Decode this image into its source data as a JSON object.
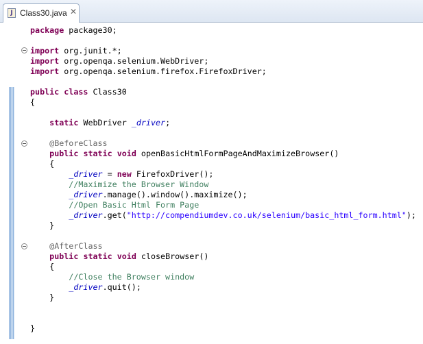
{
  "tab": {
    "icon_letter": "J",
    "filename": "Class30.java",
    "close_glyph": "✕"
  },
  "code": {
    "package_kw": "package",
    "package_rest": " package30;",
    "imports": [
      {
        "kw": "import",
        "rest": " org.junit.*;"
      },
      {
        "kw": "import",
        "rest": " org.openqa.selenium.WebDriver;"
      },
      {
        "kw": "import",
        "rest": " org.openqa.selenium.firefox.FirefoxDriver;"
      }
    ],
    "class_kw1": "public",
    "class_kw2": "class",
    "class_name": " Class30",
    "open_brace": "{",
    "field_kw": "static",
    "field_type": " WebDriver ",
    "field_name": "_driver",
    "field_end": ";",
    "before_ann": "@BeforeClass",
    "m1_kw1": "public",
    "m1_kw2": "static",
    "m1_kw3": "void",
    "m1_sig": " openBasicHtmlFormPageAndMaximizeBrowser()",
    "m1_open": "{",
    "m1_l1_var": "_driver",
    "m1_l1_mid": " = ",
    "m1_l1_new": "new",
    "m1_l1_end": " FirefoxDriver();",
    "m1_c1": "//Maximize the Browser Window",
    "m1_l2_var": "_driver",
    "m1_l2_end": ".manage().window().maximize();",
    "m1_c2": "//Open Basic Html Form Page",
    "m1_l3_var": "_driver",
    "m1_l3_mid": ".get(",
    "m1_l3_str": "\"http://compendiumdev.co.uk/selenium/basic_html_form.html\"",
    "m1_l3_end": ");",
    "m1_close": "}",
    "after_ann": "@AfterClass",
    "m2_kw1": "public",
    "m2_kw2": "static",
    "m2_kw3": "void",
    "m2_sig": " closeBrowser()",
    "m2_open": "{",
    "m2_c1": "//Close the Browser window",
    "m2_l1_var": "_driver",
    "m2_l1_end": ".quit();",
    "m2_close": "}",
    "class_close": "}"
  },
  "colors": {
    "keyword": "#7f0055",
    "field": "#0000c0",
    "annotation": "#646464",
    "comment": "#3f7f5f",
    "string": "#2a00ff"
  }
}
